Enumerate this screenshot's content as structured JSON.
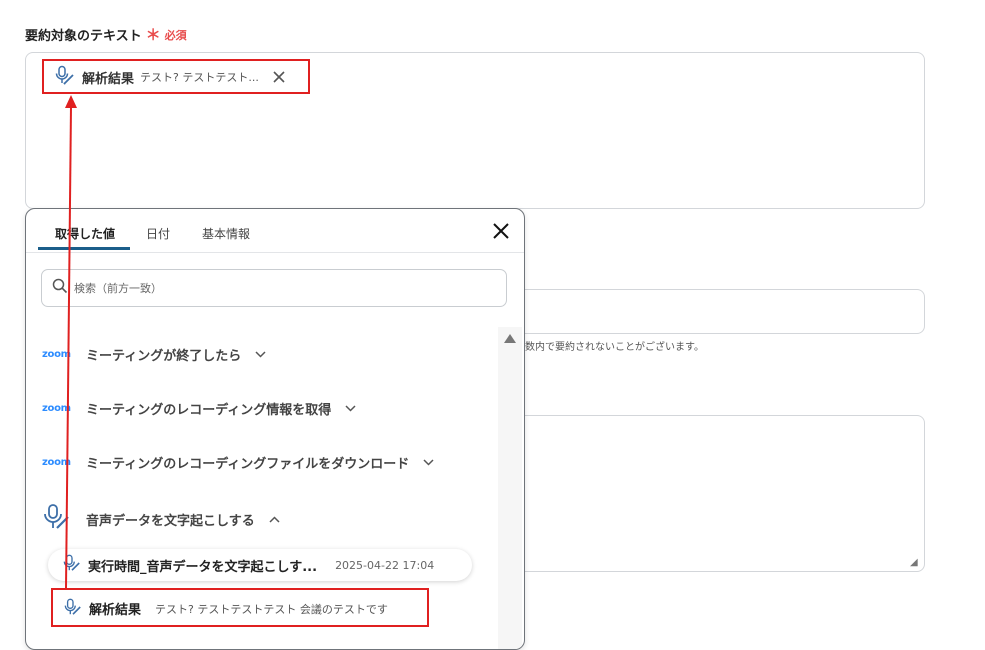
{
  "field": {
    "label": "要約対象のテキスト",
    "required_mark": "＊",
    "required_text": "必須"
  },
  "selected_chip": {
    "label": "解析結果",
    "value": "テスト? テストテスト..."
  },
  "hint_text": "数内で要約されないことがございます。",
  "popup": {
    "tabs": [
      "取得した値",
      "日付",
      "基本情報"
    ],
    "active_tab": "取得した値",
    "search_placeholder": "検索（前方一致）",
    "sections": [
      {
        "icon": "zoom",
        "label": "ミーティングが終了したら"
      },
      {
        "icon": "zoom",
        "label": "ミーティングのレコーディング情報を取得"
      },
      {
        "icon": "zoom",
        "label": "ミーティングのレコーディングファイルをダウンロード"
      },
      {
        "icon": "mic-pen",
        "label": "音声データを文字起こしする"
      }
    ],
    "zoom_logo_text": "zoom",
    "run_item": {
      "label": "実行時間_音声データを文字起こしす...",
      "time": "2025-04-22 17:04"
    },
    "result_item": {
      "label": "解析結果",
      "value": "テスト? テストテストテスト 会議のテストです"
    }
  },
  "colors": {
    "highlight": "#e02020",
    "tab_underline": "#1b5e8a",
    "required": "#e84c4c",
    "zoom": "#2d8cff"
  }
}
